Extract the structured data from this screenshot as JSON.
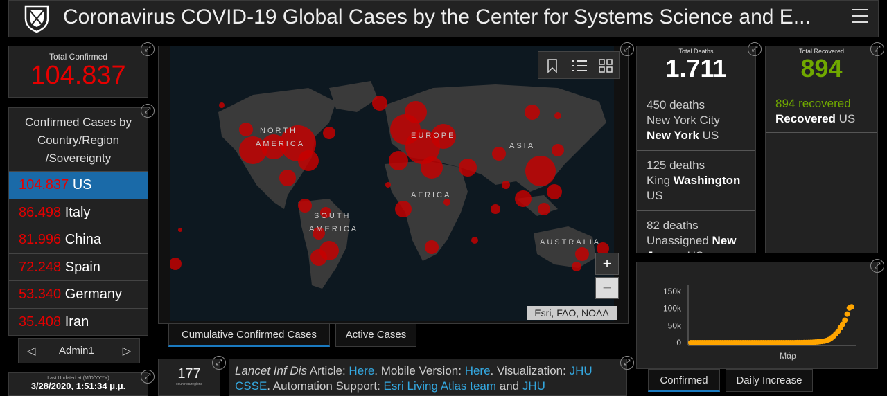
{
  "header": {
    "title": "Coronavirus COVID-19 Global Cases by the Center for Systems Science and E..."
  },
  "total_confirmed": {
    "label": "Total Confirmed",
    "value": "104.837"
  },
  "country_list": {
    "heading": "Confirmed Cases by Country/Region /Sovereignty",
    "items": [
      {
        "value": "104.837",
        "name": "US"
      },
      {
        "value": "86.498",
        "name": "Italy"
      },
      {
        "value": "81.996",
        "name": "China"
      },
      {
        "value": "72.248",
        "name": "Spain"
      },
      {
        "value": "53.340",
        "name": "Germany"
      },
      {
        "value": "35.408",
        "name": "Iran"
      }
    ],
    "nav_label": "Admin1"
  },
  "last_updated": {
    "label": "Last Updated at (M/D/YYYY)",
    "value": "3/28/2020, 1:51:34 μ.μ."
  },
  "map": {
    "labels": {
      "north_america_1": "NORTH",
      "north_america_2": "AMERICA",
      "europe": "EUROPE",
      "asia": "ASIA",
      "africa": "AFRICA",
      "south_america_1": "SOUTH",
      "south_america_2": "AMERICA",
      "australia": "AUSTRALIA"
    },
    "attribution": "Esri, FAO, NOAA",
    "zoom_in": "+",
    "zoom_out": "−",
    "tabs": [
      "Cumulative Confirmed Cases",
      "Active Cases"
    ]
  },
  "countries_count": {
    "value": "177",
    "label": "countries/regions"
  },
  "info": {
    "t1": "Lancet Inf Dis",
    "t2": " Article: ",
    "l1": "Here",
    "t3": ". Mobile Version: ",
    "l2": "Here",
    "t4": ". Visualization: ",
    "l3": "JHU CSSE",
    "t5": ". Automation Support: ",
    "l4": "Esri Living Atlas team",
    "t6": " and ",
    "l5": "JHU"
  },
  "total_deaths": {
    "label": "Total Deaths",
    "value": "1.711",
    "items": [
      {
        "count": "450 deaths",
        "place1": "New York City",
        "bold": "New York",
        "country": "US"
      },
      {
        "count": "125 deaths",
        "place1": "King",
        "bold": "Washington",
        "country": "US"
      },
      {
        "count": "82 deaths",
        "place1": "Unassigned",
        "bold": "New Jersey",
        "country": "US"
      }
    ]
  },
  "total_recovered": {
    "label": "Total Recovered",
    "value": "894",
    "items": [
      {
        "count": "894 recovered",
        "bold": "Recovered",
        "country": "US"
      }
    ]
  },
  "chart_panel": {
    "tabs": [
      "Confirmed",
      "Daily Increase"
    ]
  },
  "colors": {
    "confirmed_red": "#e60000",
    "recovered_green": "#70a800",
    "chart_orange": "#ffa500",
    "selected_blue": "#1a6aa8",
    "link_blue": "#34a8e0"
  },
  "chart_data": {
    "type": "scatter",
    "xlabel": "Μάρ",
    "ylabel": "",
    "yticks": [
      "150k",
      "100k",
      "50k",
      "0"
    ],
    "ylim": [
      0,
      150000
    ],
    "series": [
      {
        "values": [
          1,
          1,
          2,
          2,
          5,
          5,
          5,
          5,
          5,
          6,
          7,
          8,
          11,
          11,
          11,
          12,
          12,
          12,
          12,
          12,
          13,
          13,
          14,
          14,
          15,
          15,
          15,
          15,
          15,
          15,
          15,
          15,
          15,
          15,
          15,
          35,
          35,
          35,
          53,
          57,
          60,
          60,
          62,
          68,
          75,
          100,
          124,
          158,
          221,
          319,
          435,
          541,
          704,
          994,
          1301,
          1697,
          2247,
          2943,
          3680,
          4663,
          6411,
          9197,
          13677,
          19100,
          25489,
          33276,
          43847,
          53740,
          65778,
          83836,
          101657,
          104837
        ]
      }
    ]
  }
}
